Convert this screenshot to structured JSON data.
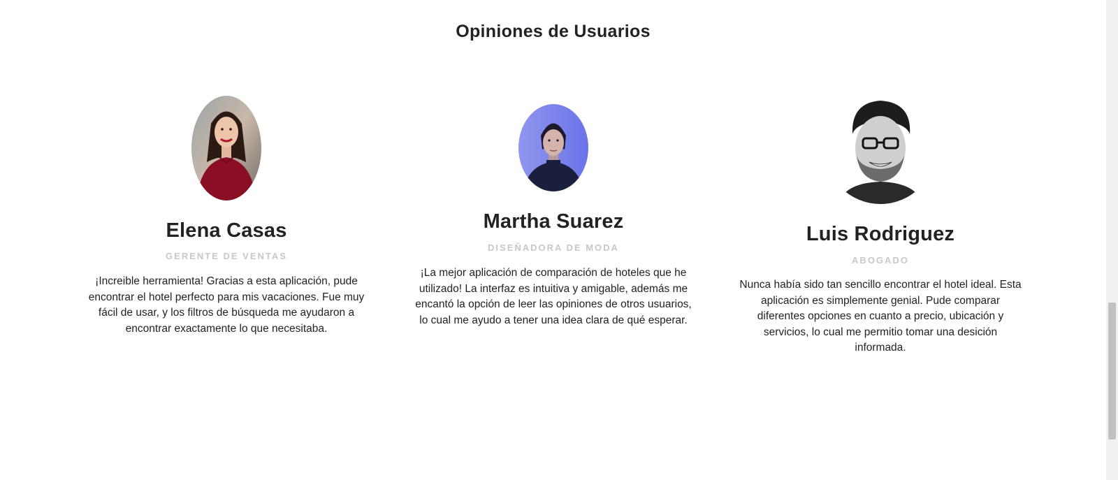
{
  "section": {
    "title": "Opiniones de Usuarios"
  },
  "testimonials": [
    {
      "name": "Elena Casas",
      "role": "GERENTE DE VENTAS",
      "quote": "¡Increible herramienta! Gracias a esta aplicación, pude encontrar el hotel perfecto para mis vacaciones. Fue muy fácil de usar, y los filtros de búsqueda me ayudaron a encontrar exactamente lo que necesitaba.",
      "photo": "woman-red-sweater-portrait",
      "accent": "#8a0f24"
    },
    {
      "name": "Martha Suarez",
      "role": "DISEÑADORA DE MODA",
      "quote": "¡La mejor aplicación de comparación de hoteles que he utilizado! La interfaz es intuitiva y amigable, además me encantó la opción de leer las opiniones de otros usuarios, lo cual me ayudo a tener una idea clara de qué esperar.",
      "photo": "woman-blue-light-portrait",
      "accent": "#7c86f0"
    },
    {
      "name": "Luis Rodriguez",
      "role": "ABOGADO",
      "quote": "Nunca había sido tan sencillo encontrar el hotel ideal. Esta aplicación es simplemente genial. Pude comparar diferentes opciones en cuanto a precio, ubicación y servicios, lo cual me permitio tomar una desición informada.",
      "photo": "man-glasses-bw-portrait",
      "accent": "#333333"
    }
  ],
  "scrollbar": {
    "position_fraction": 0.63
  }
}
